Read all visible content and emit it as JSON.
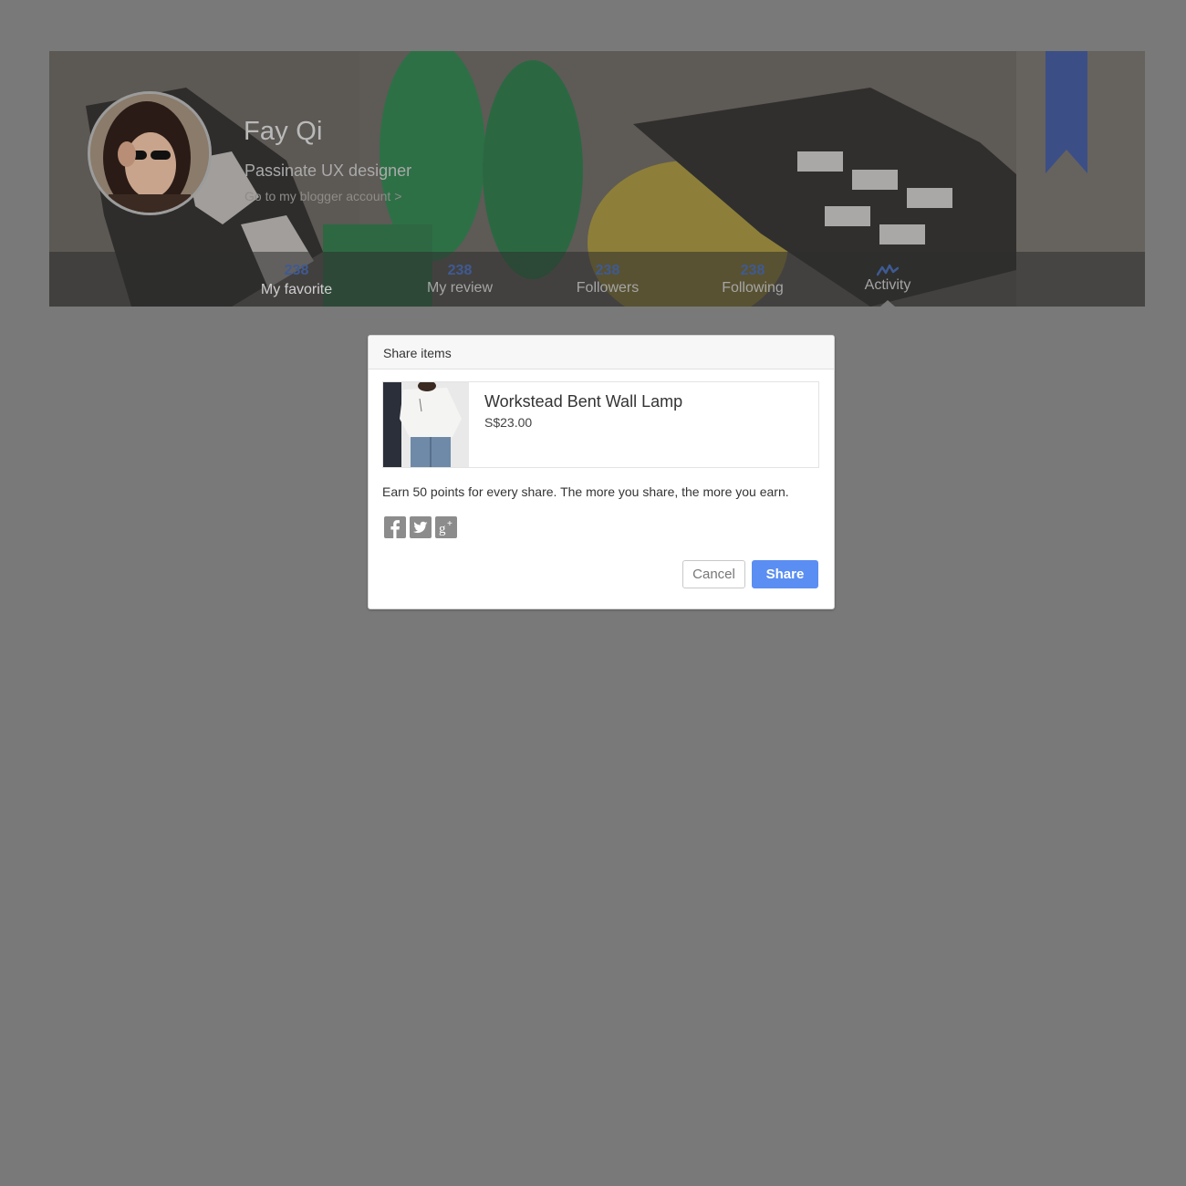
{
  "profile": {
    "name": "Fay Qi",
    "title": "Passinate UX designer",
    "blog_link": "Go to my blogger account >",
    "avatar_icon": "user-avatar-photo",
    "bookmark_color": "#3b4f86"
  },
  "stats": [
    {
      "count": "238",
      "label": "My favorite"
    },
    {
      "count": "238",
      "label": "My review"
    },
    {
      "count": "238",
      "label": "Followers"
    },
    {
      "count": "238",
      "label": "Following"
    },
    {
      "icon": "activity-icon",
      "label": "Activity",
      "selected": true
    }
  ],
  "modal": {
    "title": "Share items",
    "product": {
      "name": "Workstead Bent Wall Lamp",
      "price": "S$23.00",
      "thumbnail": "product-photo"
    },
    "promo_text": "Earn 50 points for every share. The more you share, the more you earn.",
    "social": [
      {
        "icon": "facebook-icon"
      },
      {
        "icon": "twitter-icon"
      },
      {
        "icon": "google-plus-icon"
      }
    ],
    "cancel_label": "Cancel",
    "share_label": "Share"
  },
  "colors": {
    "overlay": "#787978",
    "stat_count": "#3f5a93",
    "primary_button": "#5b8ef2"
  }
}
